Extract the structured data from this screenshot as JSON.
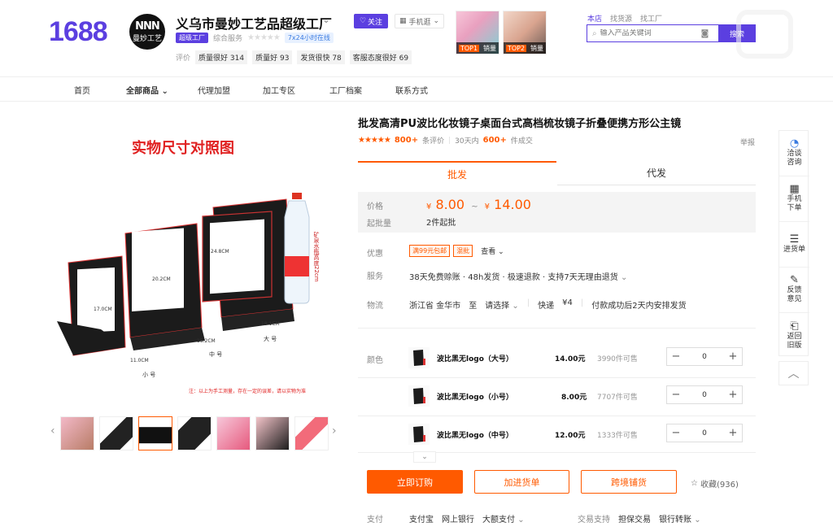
{
  "header": {
    "logo": "1688",
    "shop_name": "义乌市曼妙工艺品超级工厂",
    "avatar_text": "曼妙工艺",
    "follow": "关注",
    "mobile": "手机逛",
    "super_badge": "超级工厂",
    "composite_label": "综合服务",
    "service_badge": "7x24小时在线",
    "rating_label": "评价",
    "ratings": [
      {
        "label": "质量很好",
        "count": "314"
      },
      {
        "label": "质量好",
        "count": "93"
      },
      {
        "label": "发货很快",
        "count": "78"
      },
      {
        "label": "客服态度很好",
        "count": "69"
      }
    ],
    "top_items": [
      {
        "rank": "TOP1",
        "label": "销量"
      },
      {
        "rank": "TOP2",
        "label": "销量"
      }
    ],
    "search_tabs": [
      "本店",
      "找货源",
      "找工厂"
    ],
    "search_placeholder": "输入产品关键词",
    "search_button": "搜索"
  },
  "nav": [
    "首页",
    "全部商品",
    "代理加盟",
    "加工专区",
    "工厂档案",
    "联系方式"
  ],
  "gallery": {
    "main_title": "实物尺寸对照图",
    "note": "注：以上为手工测量，存在一定的误差，请以实物为准",
    "dims": {
      "small_h": "17.0CM",
      "medium_h": "20.2CM",
      "large_h": "24.8CM",
      "small_w": "11.0CM",
      "medium_w": "15.2CM",
      "large_w": "18.1CM",
      "bottle": "矿泉水瓶高度22cm"
    },
    "size_labels": [
      "小 号",
      "中 号",
      "大 号"
    ]
  },
  "product": {
    "title": "批发高清PU波比化妆镜子桌面台式高档梳妆镜子折叠便携方形公主镜",
    "stars": "★★★★★",
    "review_count": "800+",
    "review_label": "条评价",
    "period": "30天内",
    "sold_count": "600+",
    "sold_label": "件成交",
    "report": "举报",
    "tabs": [
      "批发",
      "代发"
    ],
    "price_label": "价格",
    "price_low": "8.00",
    "price_high": "14.00",
    "price_sep": "~",
    "currency": "¥",
    "moq_label": "起批量",
    "moq": "2件起批",
    "promo_label": "优惠",
    "promo_tags": [
      "满99元包邮",
      "混批"
    ],
    "promo_more": "查看",
    "service_label": "服务",
    "service_text": "38天免费赊账 · 48h发货 · 极速退款 · 支持7天无理由退货",
    "logistics_label": "物流",
    "ship_from": "浙江省 金华市",
    "ship_to_label": "至",
    "ship_to": "请选择",
    "express": "快递",
    "express_fee": "¥4",
    "ship_time": "付款成功后2天内安排发货",
    "color_label": "颜色",
    "skus": [
      {
        "name": "波比黑无logo（大号）",
        "price": "14.00元",
        "stock": "3990件可售",
        "qty": "0"
      },
      {
        "name": "波比黑无logo（小号）",
        "price": "8.00元",
        "stock": "7707件可售",
        "qty": "0"
      },
      {
        "name": "波比黑无logo（中号）",
        "price": "12.00元",
        "stock": "1333件可售",
        "qty": "0"
      }
    ],
    "buy_now": "立即订购",
    "add_cart": "加进货单",
    "cross_border": "跨境铺货",
    "favorite": "收藏(936)",
    "pay_label": "支付",
    "pay_methods": [
      "支付宝",
      "网上银行",
      "大额支付"
    ],
    "trade_label": "交易支持",
    "trade_methods": [
      "担保交易",
      "银行转账"
    ]
  },
  "sidebar": [
    {
      "label": "洽谈咨询",
      "icon": "chat-icon"
    },
    {
      "label": "手机下单",
      "icon": "qrcode-icon"
    },
    {
      "label": "进货单",
      "icon": "list-icon"
    },
    {
      "label": "反馈意见",
      "icon": "edit-icon"
    },
    {
      "label": "返回旧版",
      "icon": "return-icon"
    }
  ],
  "colors": {
    "brand": "#5b3fe0",
    "accent": "#ff5a00"
  }
}
